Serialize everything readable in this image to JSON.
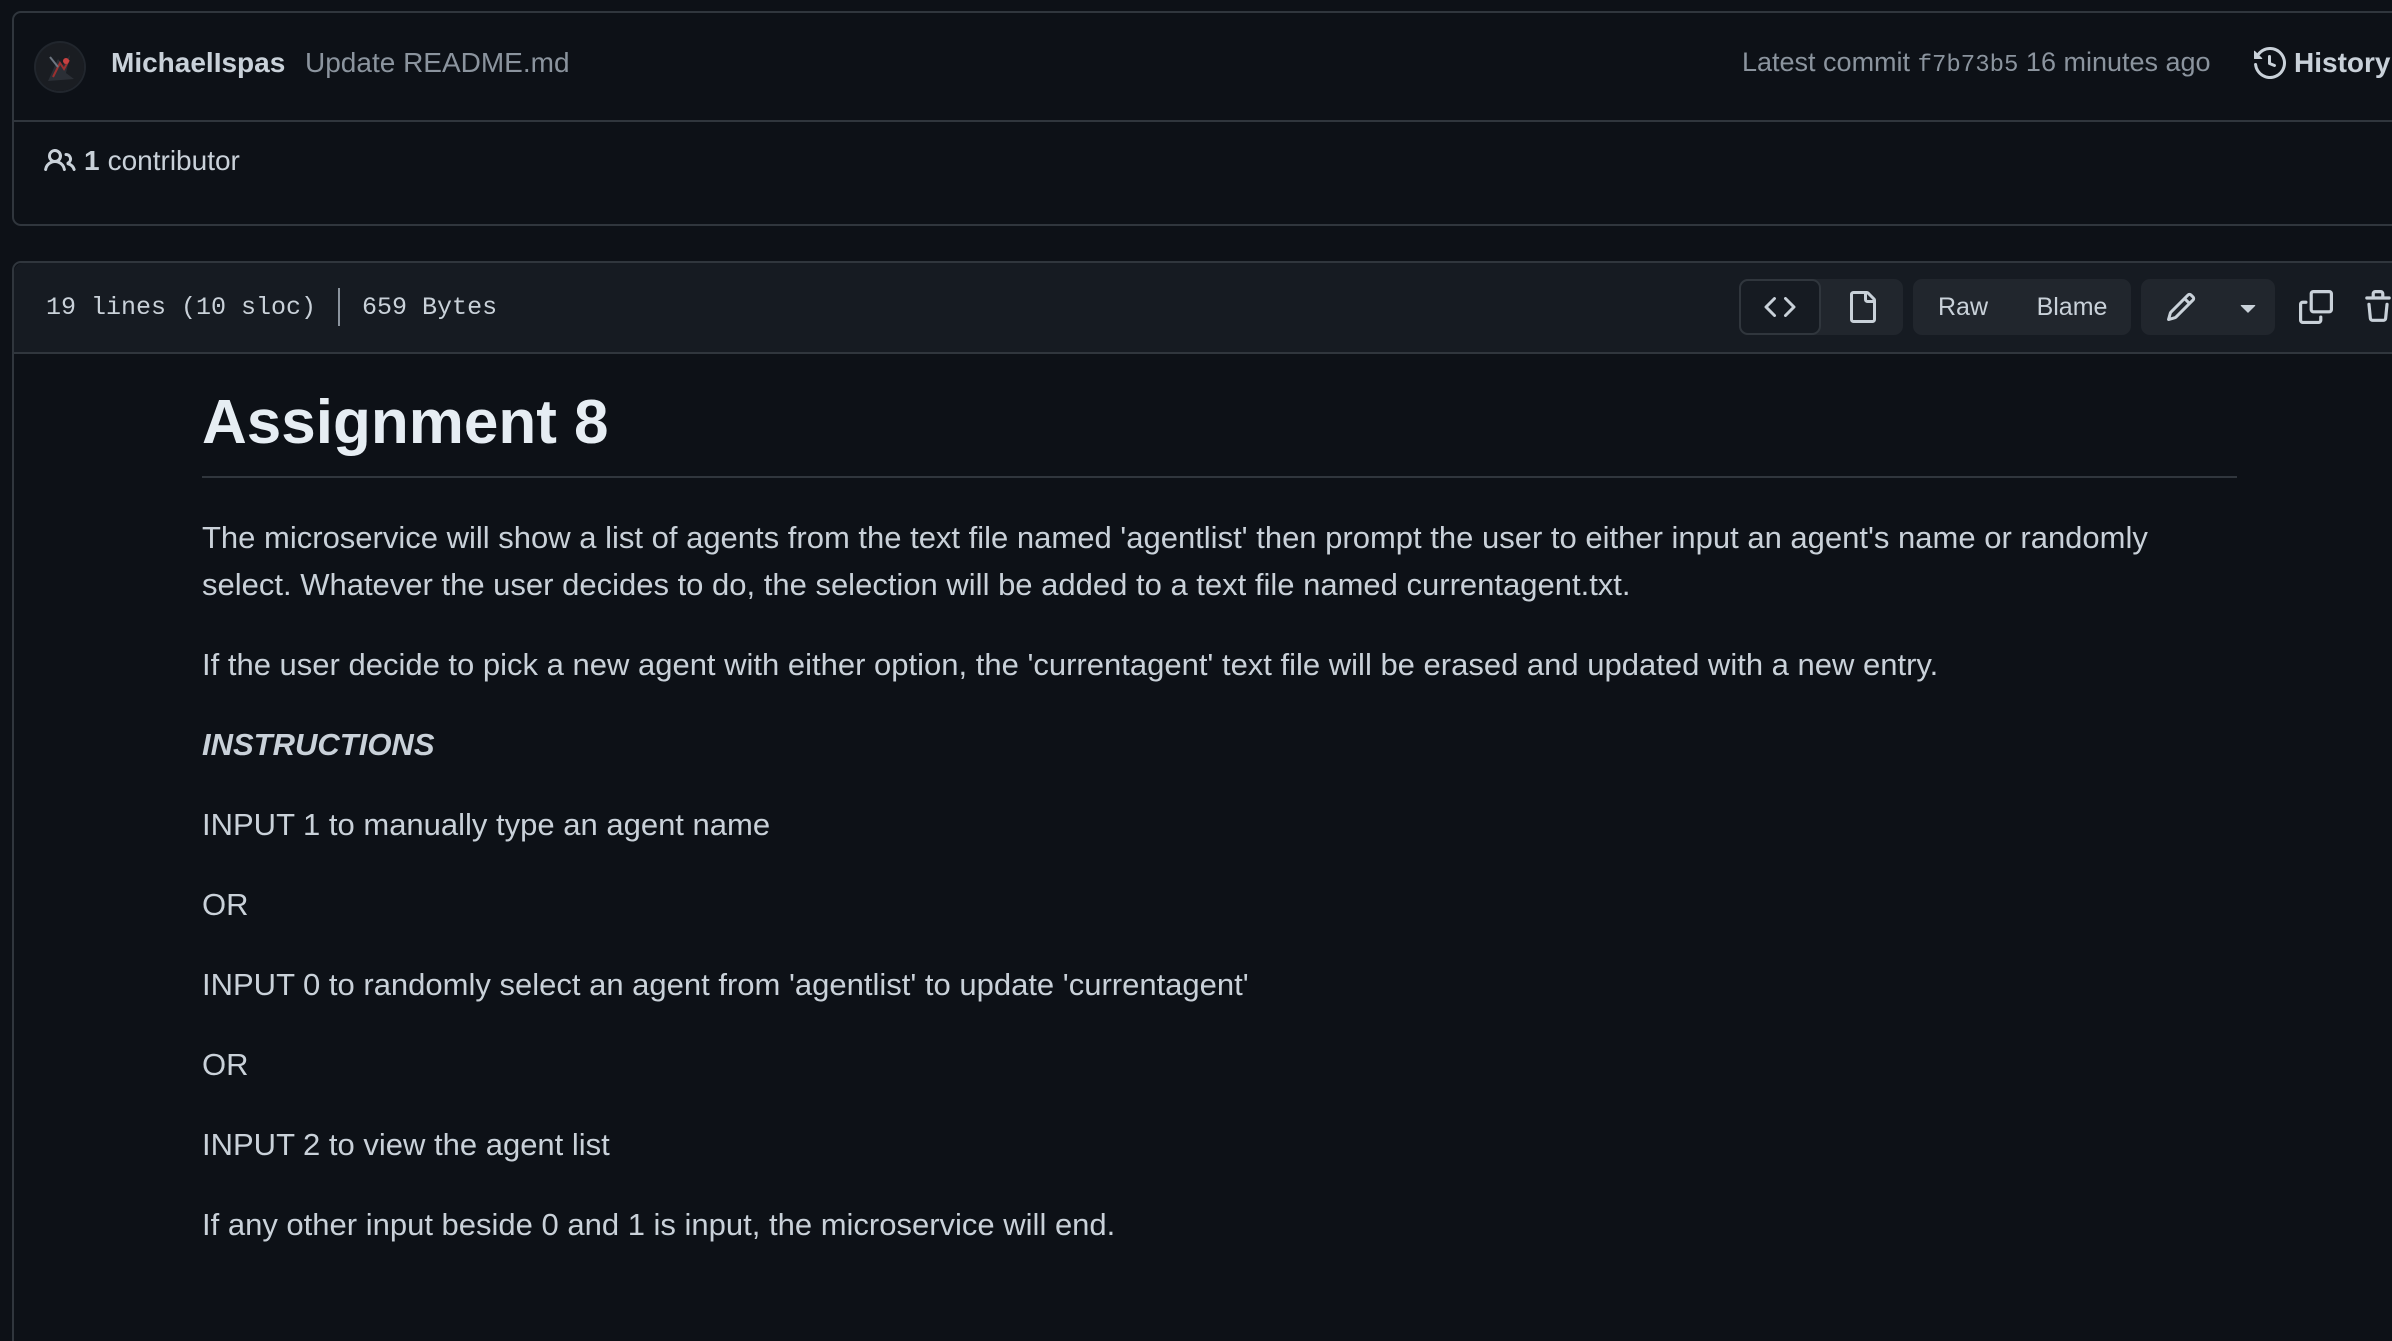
{
  "commit": {
    "author": "MichaelIspas",
    "message": "Update README.md",
    "latest_label": "Latest commit",
    "sha": "f7b73b5",
    "time": "16 minutes ago",
    "history_label": "History"
  },
  "contributors": {
    "count": "1",
    "label": "contributor"
  },
  "file": {
    "lines": "19 lines (10 sloc)",
    "size": "659 Bytes",
    "raw_label": "Raw",
    "blame_label": "Blame"
  },
  "readme": {
    "title": "Assignment 8",
    "paragraphs": {
      "p1": "The microservice will show a list of agents from the text file named 'agentlist' then prompt the user to either input an agent's name or randomly select. Whatever the user decides to do, the selection will be added to a text file named currentagent.txt.",
      "p2": "If the user decide to pick a new agent with either option, the 'currentagent' text file will be erased and updated with a new entry.",
      "p3": "INSTRUCTIONS",
      "p4": "INPUT 1 to manually type an agent name",
      "p5": "OR",
      "p6": "INPUT 0 to randomly select an agent from 'agentlist' to update 'currentagent'",
      "p7": "OR",
      "p8": "INPUT 2 to view the agent list",
      "p9": "If any other input beside 0 and 1 is input, the microservice will end."
    }
  },
  "icons": {
    "history": "history-icon",
    "contributors": "people-icon",
    "code": "code-icon",
    "preview": "file-icon",
    "edit": "pencil-icon",
    "caret": "triangle-down-icon",
    "copy": "copy-icon",
    "delete": "trash-icon"
  },
  "colors": {
    "background": "#0d1117",
    "border": "#30363d",
    "text": "#c9d1d9",
    "muted": "#8b949e",
    "button_bg": "#21262d"
  }
}
